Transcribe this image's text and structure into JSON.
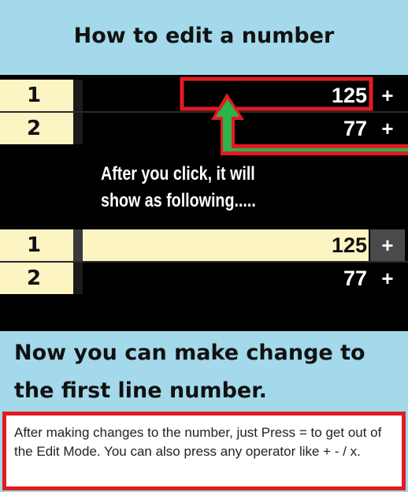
{
  "page_title": "How to edit a number",
  "before_rows": [
    {
      "index": "1",
      "value": "125",
      "op": "+"
    },
    {
      "index": "2",
      "value": "77",
      "op": "+"
    }
  ],
  "callout_text": "After you click, it will show as following.....",
  "after_rows": [
    {
      "index": "1",
      "value": "125",
      "op": "+"
    },
    {
      "index": "2",
      "value": "77",
      "op": "+"
    }
  ],
  "heading2": "Now you can make change to the first line number.",
  "note": "After making changes to the number, just Press = to get out of the Edit Mode. You can also press any operator like + - / x.",
  "colors": {
    "background": "#a3d9ea",
    "highlight": "#e21b23",
    "arrow": "#2db34a",
    "row_label": "#fdf4c4"
  },
  "icons": [
    "arrow-up-icon"
  ]
}
